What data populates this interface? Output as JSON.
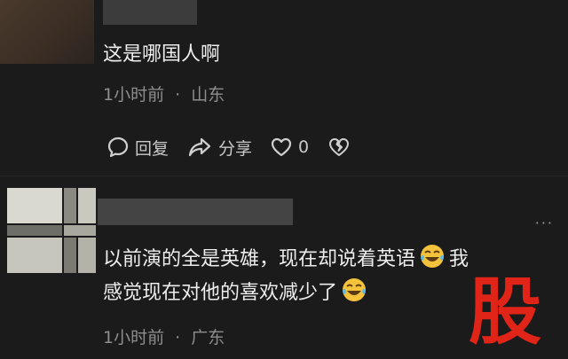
{
  "comments": [
    {
      "text": "这是哪国人啊",
      "time": "1小时前",
      "sep": "·",
      "location": "山东",
      "reply_label": "回复",
      "share_label": "分享",
      "like_count": "0"
    },
    {
      "text_line1": "以前演的全是英雄，现在却说着英语",
      "text_line1_tail": "我",
      "text_line2": "感觉现在对他的喜欢减少了",
      "time": "1小时前",
      "sep": "·",
      "location": "广东",
      "more": "···"
    }
  ],
  "watermark": "股",
  "colors": {
    "background": "#1b1b1b",
    "watermark": "#e02418",
    "meta_text": "#8e8e8e"
  },
  "icons": [
    "reply-bubble-icon",
    "share-arrow-icon",
    "heart-like-icon",
    "broken-heart-dislike-icon",
    "tears-of-joy-emoji",
    "more-dots-icon"
  ]
}
